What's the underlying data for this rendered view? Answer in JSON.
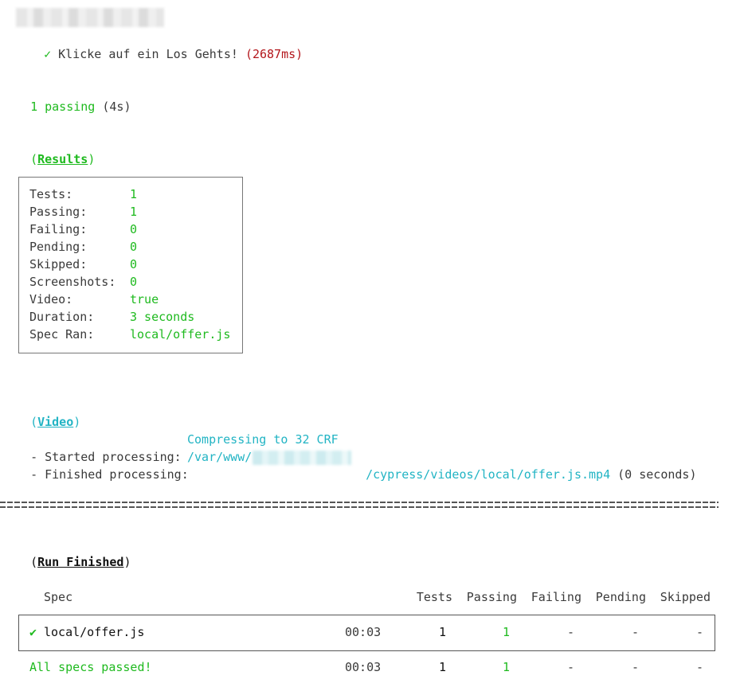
{
  "header": {
    "test_check": "✓",
    "test_title": "Klicke auf ein Los Gehts!",
    "test_duration": "(2687ms)"
  },
  "summary": {
    "passing": "1 passing",
    "passing_time": "(4s)"
  },
  "results": {
    "open_paren": "(",
    "heading": "Results",
    "close_paren": ")",
    "rows": [
      {
        "label": "Tests:",
        "value": "1"
      },
      {
        "label": "Passing:",
        "value": "1"
      },
      {
        "label": "Failing:",
        "value": "0"
      },
      {
        "label": "Pending:",
        "value": "0"
      },
      {
        "label": "Skipped:",
        "value": "0"
      },
      {
        "label": "Screenshots:",
        "value": "0"
      },
      {
        "label": "Video:",
        "value": "true"
      },
      {
        "label": "Duration:",
        "value": "3 seconds"
      },
      {
        "label": "Spec Ran:",
        "value": "local/offer.js"
      }
    ]
  },
  "video": {
    "open_paren": "(",
    "heading": "Video",
    "close_paren": ")",
    "started_label": "- Started processing:",
    "started_value": "Compressing to 32 CRF",
    "finished_label": "- Finished processing:",
    "finished_path_prefix": "/var/www/",
    "finished_path_suffix": "/cypress/videos/local/offer.js.mp4",
    "finished_time": "(0 seconds)"
  },
  "run_finished": {
    "open_paren": "(",
    "heading": "Run Finished",
    "close_paren": ")",
    "columns": [
      "Spec",
      "Tests",
      "Passing",
      "Failing",
      "Pending",
      "Skipped"
    ],
    "row": {
      "check": "✔",
      "spec": "local/offer.js",
      "time": "00:03",
      "tests": "1",
      "passing": "1",
      "failing": "-",
      "pending": "-",
      "skipped": "-"
    },
    "total": {
      "label": "All specs passed!",
      "time": "00:03",
      "tests": "1",
      "passing": "1",
      "failing": "-",
      "pending": "-",
      "skipped": "-"
    }
  },
  "colors": {
    "pass": "#1fba1f",
    "fail_time": "#b3161b",
    "info": "#22b4c4",
    "text": "#3a3a3a"
  }
}
